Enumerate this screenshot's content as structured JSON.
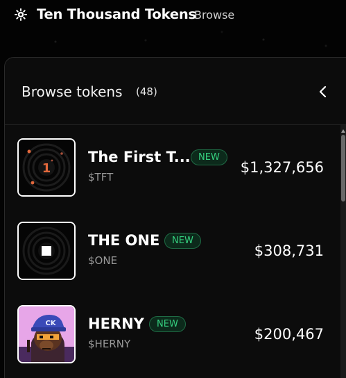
{
  "app": {
    "title": "Ten Thousand Tokens",
    "logo_icon": "sun-gear-icon"
  },
  "nav": {
    "browse_label": "Browse"
  },
  "panel": {
    "title": "Browse tokens",
    "count": "(48)",
    "collapse_icon": "chevron-left-icon"
  },
  "tokens": [
    {
      "name": "The First T...",
      "badge": "NEW",
      "ticker": "$TFT",
      "price": "$1,327,656",
      "thumb_label": "1"
    },
    {
      "name": "THE ONE",
      "badge": "NEW",
      "ticker": "$ONE",
      "price": "$308,731"
    },
    {
      "name": "HERNY",
      "badge": "NEW",
      "ticker": "$HERNY",
      "price": "$200,467",
      "thumb_label": "CK"
    }
  ],
  "colors": {
    "badge_text": "#35d07f",
    "badge_bg": "#0c2a1b",
    "accent_orange": "#e2683c"
  }
}
